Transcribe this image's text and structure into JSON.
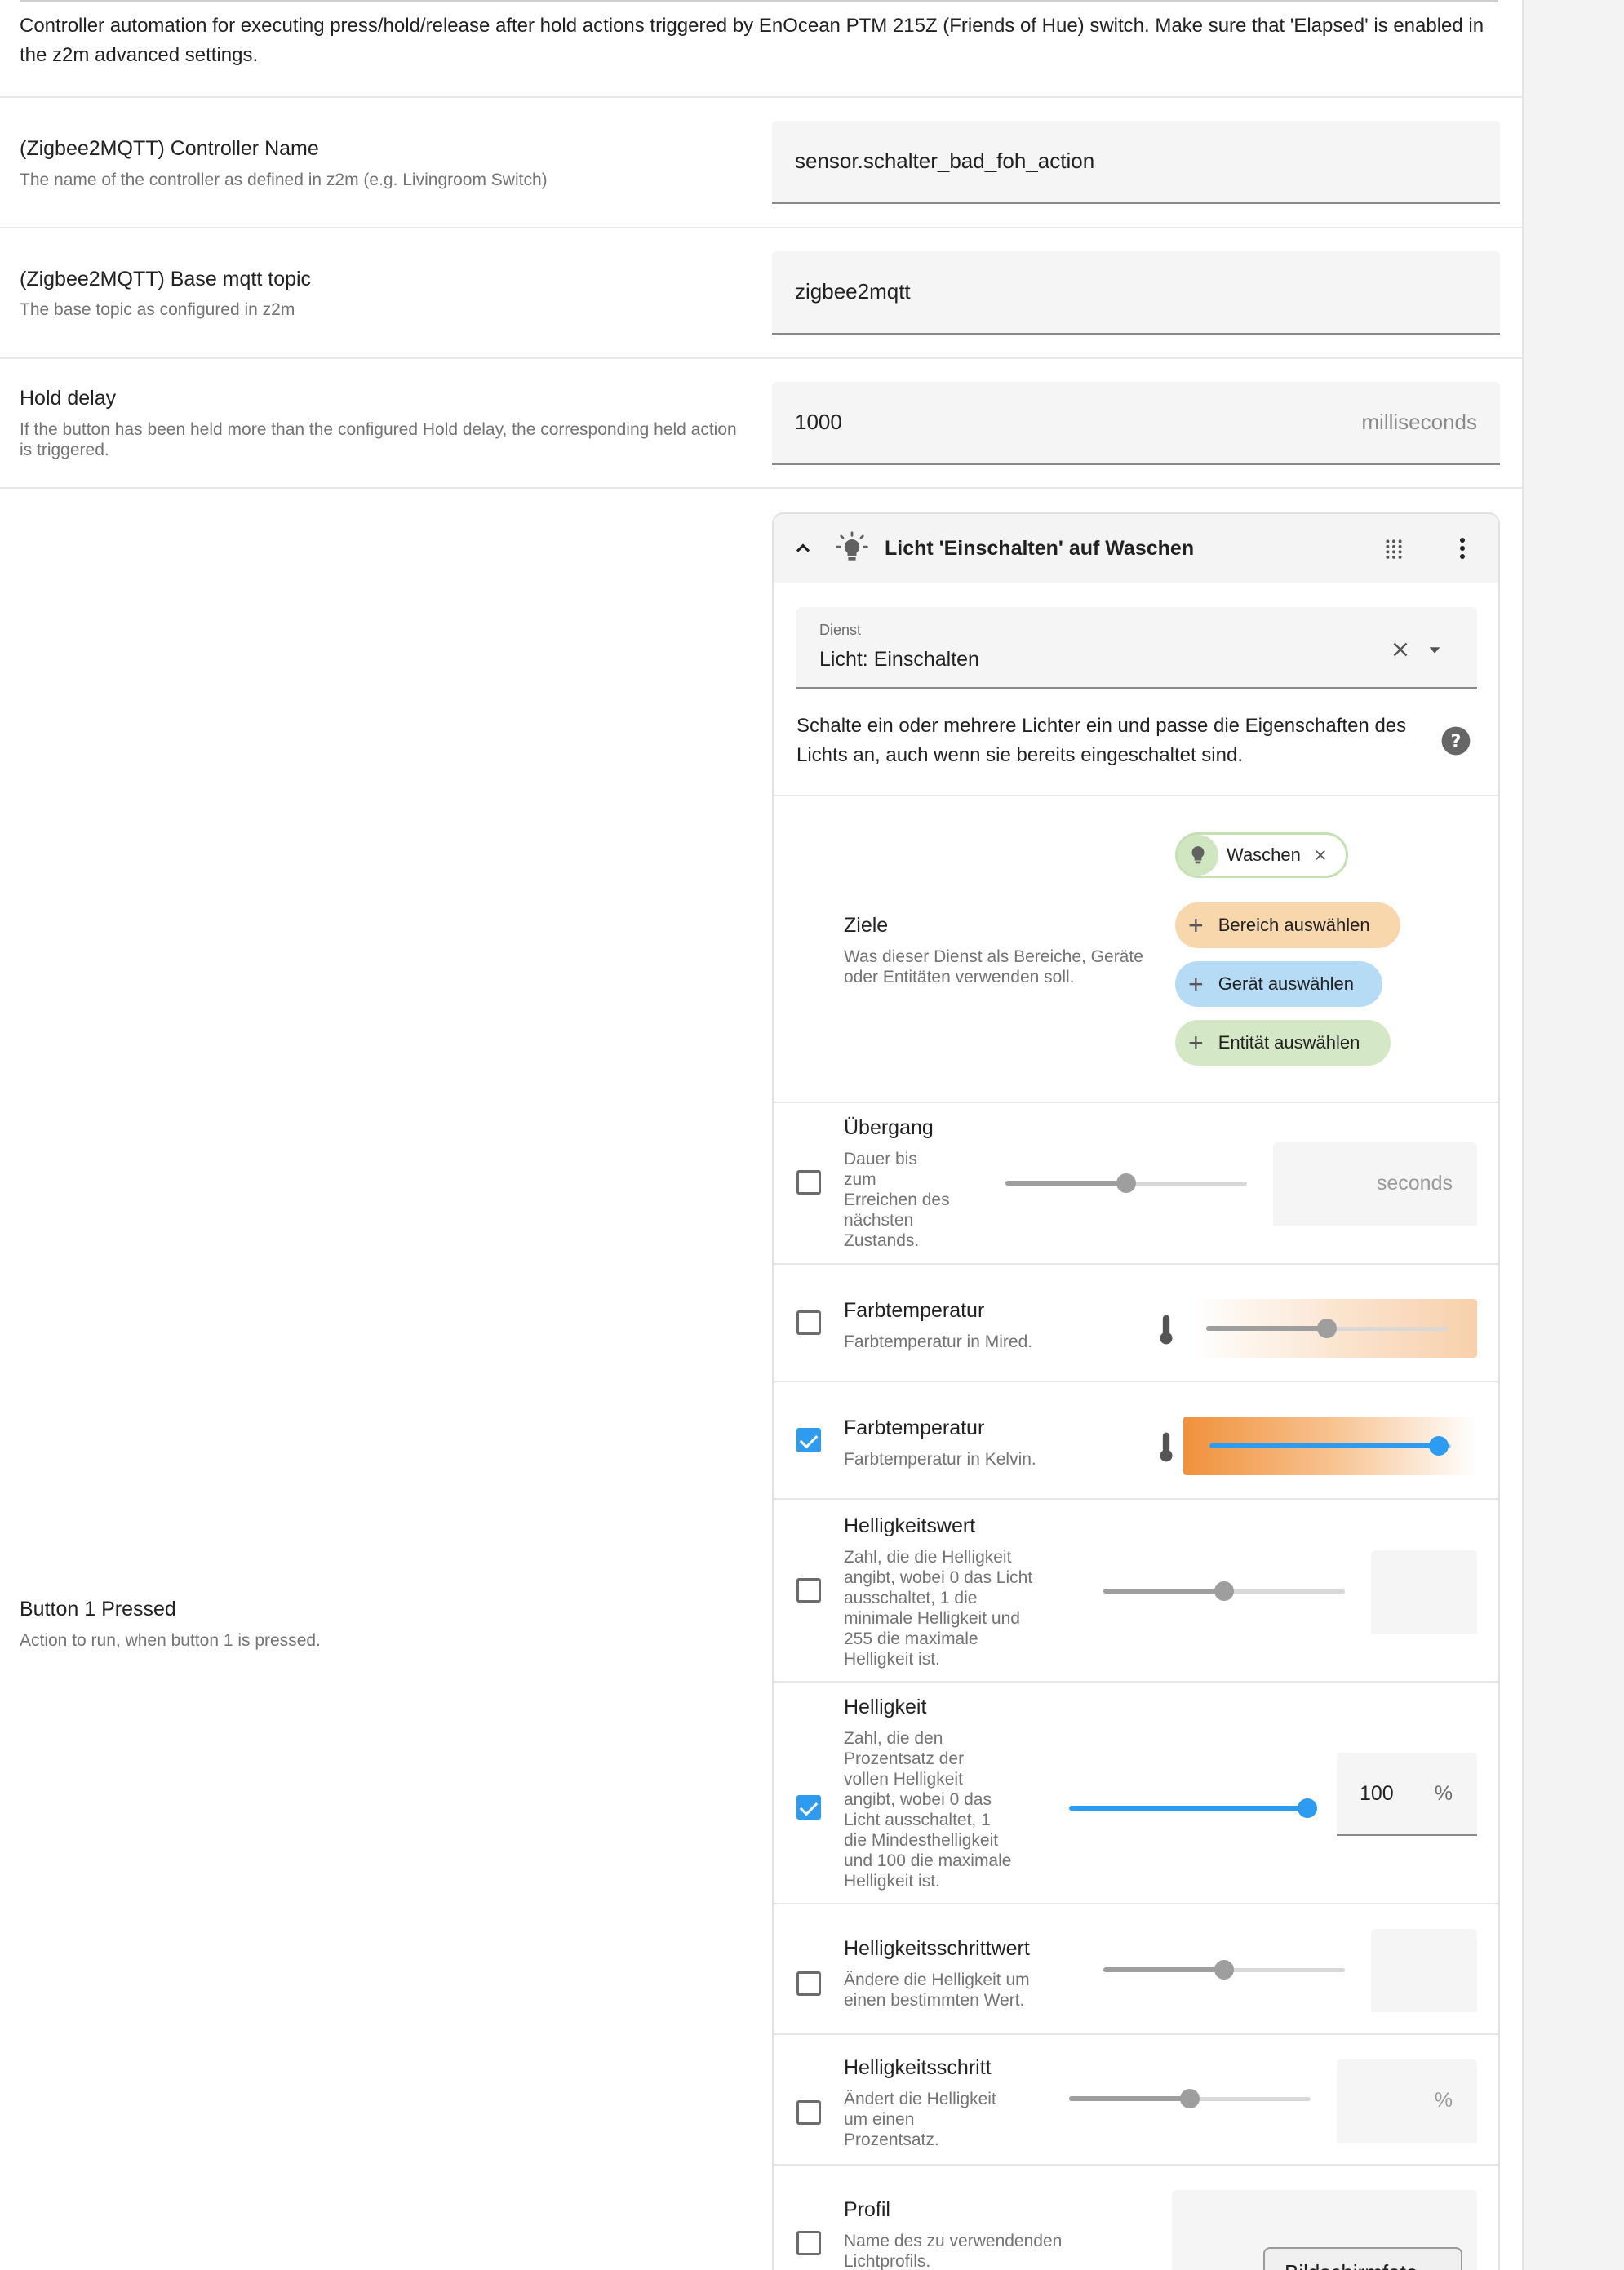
{
  "intro": {
    "description": "Controller automation for executing press/hold/release after hold actions triggered by EnOcean PTM 215Z (Friends of Hue) switch. Make sure that 'Elapsed' is enabled in the z2m advanced settings."
  },
  "fields": {
    "controller_name": {
      "title": "(Zigbee2MQTT) Controller Name",
      "description": "The name of the controller as defined in z2m (e.g. Livingroom Switch)",
      "value": "sensor.schalter_bad_foh_action"
    },
    "base_topic": {
      "title": "(Zigbee2MQTT) Base mqtt topic",
      "description": "The base topic as configured in z2m",
      "value": "zigbee2mqtt"
    },
    "hold_delay": {
      "title": "Hold delay",
      "description": "If the button has been held more than the configured Hold delay, the corresponding held action is triggered.",
      "value": "1000",
      "unit": "milliseconds"
    },
    "button1_pressed": {
      "title": "Button 1 Pressed",
      "description": "Action to run, when button 1 is pressed."
    }
  },
  "action_card": {
    "title": "Licht 'Einschalten' auf Waschen",
    "icons": {
      "collapse": "chevron-up-icon",
      "type": "lightbulb-icon",
      "drag": "drag-handle-icon",
      "menu": "more-vertical-icon"
    },
    "service": {
      "label": "Dienst",
      "value": "Licht: Einschalten",
      "description": "Schalte ein oder mehrere Lichter ein und passe die Eigenschaften des Lichts an, auch wenn sie bereits eingeschaltet sind."
    },
    "targets": {
      "title": "Ziele",
      "description": "Was dieser Dienst als Bereiche, Geräte oder Entitäten verwenden soll.",
      "selected_chip": "Waschen",
      "add_area": "Bereich auswählen",
      "add_device": "Gerät auswählen",
      "add_entity": "Entität auswählen",
      "colors": {
        "area": "#f9d7ad",
        "device": "#b5dbf5",
        "entity": "#d4e8c6"
      }
    },
    "params": {
      "transition": {
        "title": "Übergang",
        "description_lines": [
          "Dauer bis",
          "zum",
          "Erreichen des",
          "nächsten",
          "Zustands."
        ],
        "unit": "seconds",
        "checked": false,
        "slider_fraction": 0.5
      },
      "color_temp_mired": {
        "title": "Farbtemperatur",
        "description": "Farbtemperatur in Mired.",
        "checked": false,
        "slider_fraction": 0.5
      },
      "color_temp_kelvin": {
        "title": "Farbtemperatur",
        "description": "Farbtemperatur in Kelvin.",
        "checked": true,
        "slider_fraction": 0.95
      },
      "brightness_value": {
        "title": "Helligkeitswert",
        "description_lines": [
          "Zahl, die die Helligkeit",
          "angibt, wobei 0 das Licht",
          "ausschaltet, 1 die",
          "minimale Helligkeit und",
          "255 die maximale",
          "Helligkeit ist."
        ],
        "checked": false,
        "slider_fraction": 0.5
      },
      "brightness_pct": {
        "title": "Helligkeit",
        "description_lines": [
          "Zahl, die den",
          "Prozentsatz der",
          "vollen Helligkeit",
          "angibt, wobei 0 das",
          "Licht ausschaltet, 1",
          "die Mindesthelligkeit",
          "und 100 die maximale",
          "Helligkeit ist."
        ],
        "checked": true,
        "value": "100",
        "unit": "%",
        "slider_fraction": 1.0
      },
      "brightness_step": {
        "title": "Helligkeitsschrittwert",
        "description_lines": [
          "Ändere die Helligkeit um",
          "einen bestimmten Wert."
        ],
        "checked": false,
        "slider_fraction": 0.5
      },
      "brightness_step_pct": {
        "title": "Helligkeitsschritt",
        "description_lines": [
          "Ändert die Helligkeit",
          "um einen",
          "Prozentsatz."
        ],
        "unit": "%",
        "checked": false,
        "slider_fraction": 0.5
      },
      "profile": {
        "title": "Profil",
        "description_lines": [
          "Name des zu verwendenden",
          "Lichtprofils."
        ],
        "checked": false
      }
    }
  },
  "overlay": {
    "screenshot_button": "Bildschirmfoto"
  },
  "colors": {
    "accent": "#2d9bf0",
    "warm": "#f0913a"
  }
}
